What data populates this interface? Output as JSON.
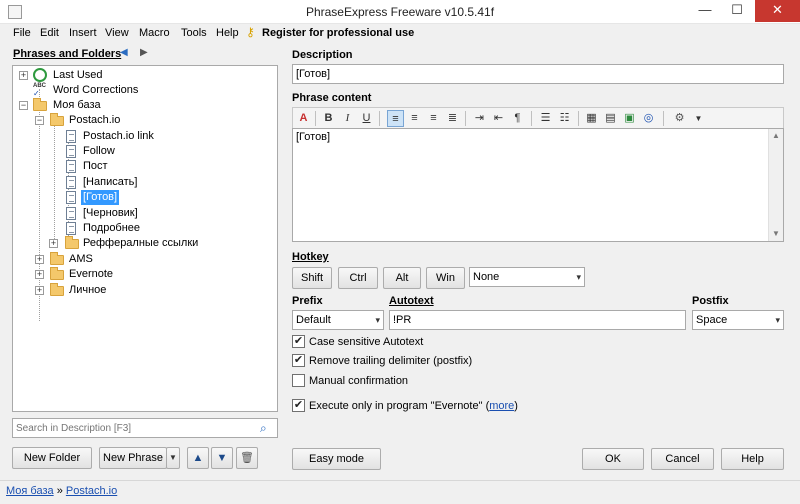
{
  "window": {
    "title": "PhraseExpress Freeware v10.5.41f",
    "minimize_glyph": "—",
    "maximize_glyph": "☐",
    "close_glyph": "✕",
    "app_icon": "document-icon"
  },
  "menu": {
    "items": [
      "File",
      "Edit",
      "Insert",
      "View",
      "Macro",
      "Tools",
      "Help"
    ],
    "register_label": "Register for professional use",
    "register_icon": "key-icon"
  },
  "left_panel": {
    "header": "Phrases and Folders",
    "nav_back_glyph": "◀",
    "nav_forward_glyph": "▶",
    "tree": {
      "last_used": "Last Used",
      "word_corrections": "Word Corrections",
      "word_corrections_icon_text": "ABC",
      "my_base": "Моя база",
      "postach_folder": "Postach.io",
      "items": [
        "Postach.io link",
        "Follow",
        "Пост",
        "[Написать]",
        "[Готов]",
        "[Черновик]",
        "Подробнее"
      ],
      "selected_index": 4,
      "referral_folder": "Реффералные ссылки",
      "ams": "AMS",
      "evernote": "Evernote",
      "personal": "Личное"
    },
    "search": {
      "placeholder": "Search in Description [F3]"
    },
    "buttons": {
      "new_folder": "New Folder",
      "new_phrase": "New Phrase",
      "dropdown_glyph": "▼",
      "up_glyph": "▲",
      "down_glyph": "▼",
      "delete_glyph": "🗑"
    }
  },
  "right_panel": {
    "description_label": "Description",
    "description_value": "[Готов]",
    "phrase_content_label": "Phrase content",
    "phrase_content_value": "[Готов]",
    "toolbar": {
      "bold": "B",
      "italic": "I",
      "underline": "U"
    },
    "hotkey": {
      "label": "Hotkey",
      "shift": "Shift",
      "ctrl": "Ctrl",
      "alt": "Alt",
      "win": "Win",
      "key_value": "None"
    },
    "prefix": {
      "label": "Prefix",
      "value": "Default"
    },
    "autotext": {
      "label": "Autotext",
      "value": "!PR"
    },
    "postfix": {
      "label": "Postfix",
      "value": "Space"
    },
    "options": {
      "case_sensitive": "Case sensitive Autotext",
      "case_sensitive_checked": true,
      "remove_trailing": "Remove trailing delimiter (postfix)",
      "remove_trailing_checked": true,
      "manual_confirmation": "Manual confirmation",
      "manual_confirmation_checked": false,
      "execute_only": "Execute only in program \"Evernote\" (",
      "execute_only_link": "more",
      "execute_only_suffix": ")",
      "execute_only_checked": true
    },
    "buttons": {
      "easy_mode": "Easy mode",
      "ok": "OK",
      "cancel": "Cancel",
      "help": "Help"
    }
  },
  "statusbar": {
    "crumb1": "Моя база",
    "separator": "»",
    "crumb2": "Postach.io"
  },
  "checkmark": "✔"
}
